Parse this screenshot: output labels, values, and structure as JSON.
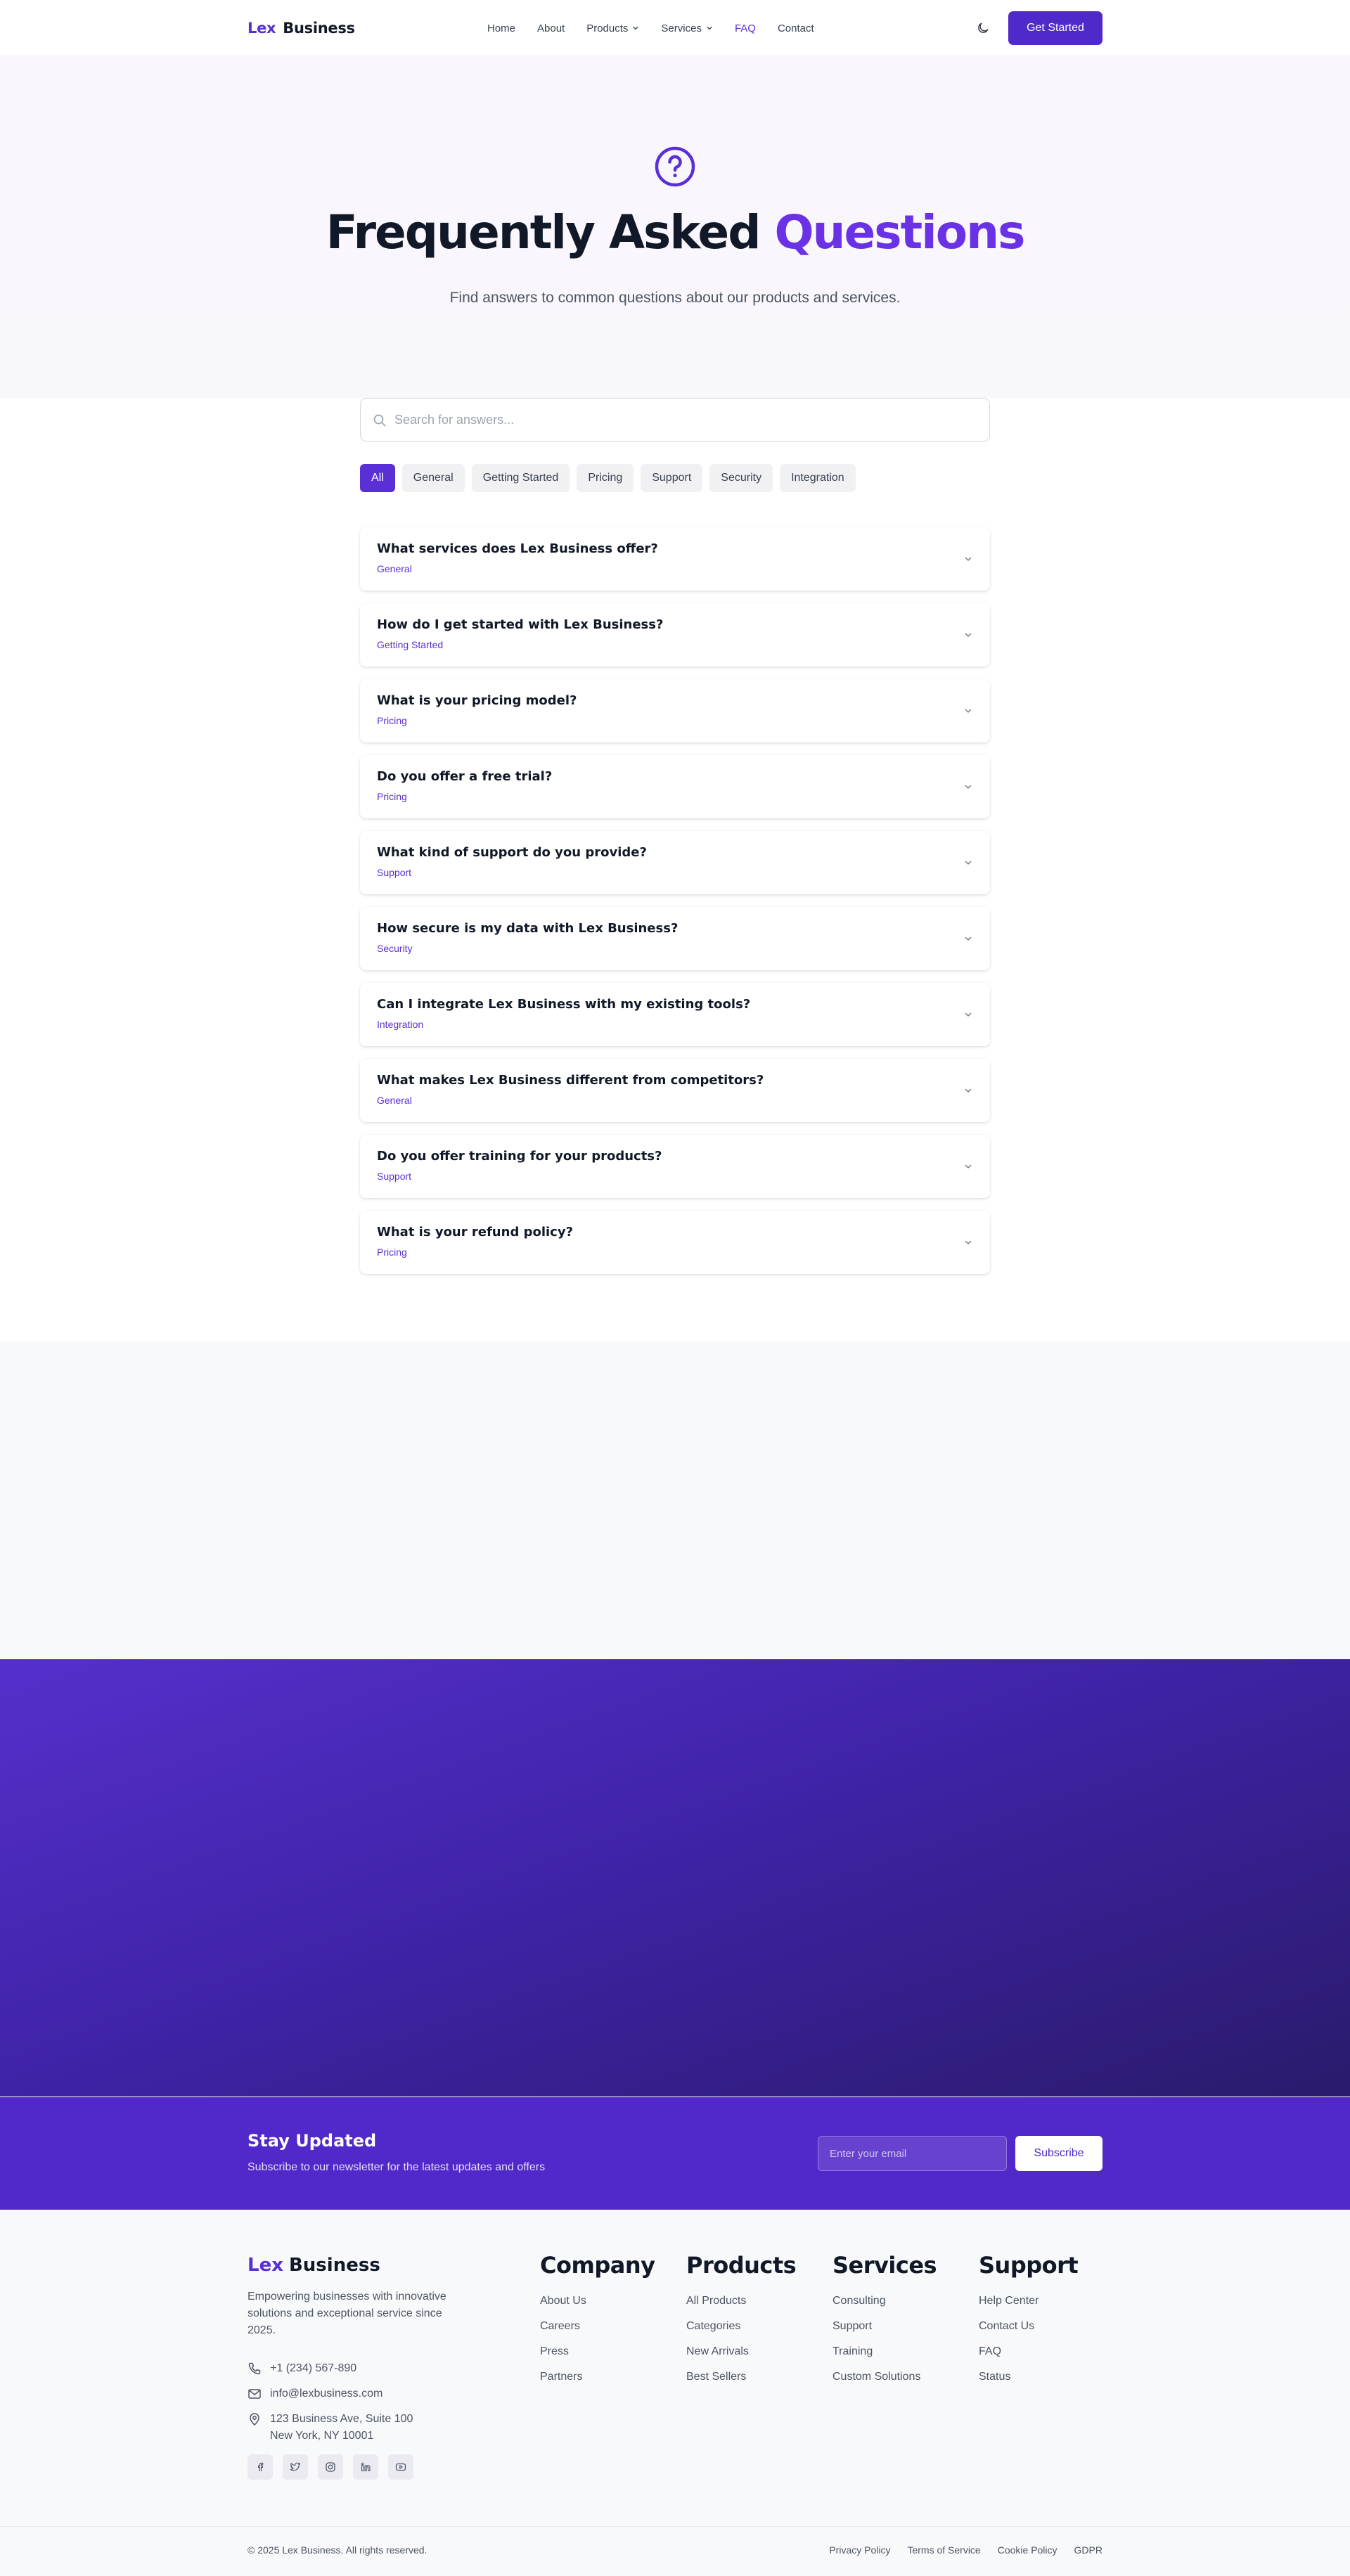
{
  "nav": {
    "logo_lex": "Lex",
    "logo_business": "Business",
    "items": [
      {
        "label": "Home"
      },
      {
        "label": "About"
      },
      {
        "label": "Products"
      },
      {
        "label": "Services"
      },
      {
        "label": "FAQ"
      },
      {
        "label": "Contact"
      }
    ],
    "active_item": "FAQ",
    "cta_label": "Get Started",
    "theme_icon": "moon-icon"
  },
  "hero": {
    "icon": "question-circle-icon",
    "title_main": "Frequently Asked",
    "title_accent": "Questions",
    "subtitle": "Find answers to common questions about our products and services."
  },
  "search": {
    "placeholder": "Search for answers...",
    "value": ""
  },
  "filters": {
    "active": "All",
    "items": [
      "All",
      "General",
      "Getting Started",
      "Pricing",
      "Support",
      "Security",
      "Integration"
    ]
  },
  "faqs": [
    {
      "question": "What services does Lex Business offer?",
      "category": "General"
    },
    {
      "question": "How do I get started with Lex Business?",
      "category": "Getting Started"
    },
    {
      "question": "What is your pricing model?",
      "category": "Pricing"
    },
    {
      "question": "Do you offer a free trial?",
      "category": "Pricing"
    },
    {
      "question": "What kind of support do you provide?",
      "category": "Support"
    },
    {
      "question": "How secure is my data with Lex Business?",
      "category": "Security"
    },
    {
      "question": "Can I integrate Lex Business with my existing tools?",
      "category": "Integration"
    },
    {
      "question": "What makes Lex Business different from competitors?",
      "category": "General"
    },
    {
      "question": "Do you offer training for your products?",
      "category": "Support"
    },
    {
      "question": "What is your refund policy?",
      "category": "Pricing"
    }
  ],
  "newsletter": {
    "title": "Stay Updated",
    "subtitle": "Subscribe to our newsletter for the latest updates and offers",
    "placeholder": "Enter your email",
    "button_label": "Subscribe"
  },
  "footer": {
    "logo_lex": "Lex",
    "logo_business": "Business",
    "description": "Empowering businesses with innovative solutions and exceptional service since 2025.",
    "phone": "+1 (234) 567-890",
    "email": "info@lexbusiness.com",
    "address_line1": "123 Business Ave, Suite 100",
    "address_line2": "New York, NY 10001",
    "socials": [
      "facebook-icon",
      "twitter-icon",
      "instagram-icon",
      "linkedin-icon",
      "youtube-icon"
    ],
    "columns": [
      {
        "title": "Company",
        "links": [
          "About Us",
          "Careers",
          "Press",
          "Partners"
        ]
      },
      {
        "title": "Products",
        "links": [
          "All Products",
          "Categories",
          "New Arrivals",
          "Best Sellers"
        ]
      },
      {
        "title": "Services",
        "links": [
          "Consulting",
          "Support",
          "Training",
          "Custom Solutions"
        ]
      },
      {
        "title": "Support",
        "links": [
          "Help Center",
          "Contact Us",
          "FAQ",
          "Status"
        ]
      }
    ],
    "copyright": "© 2025 Lex Business. All rights reserved.",
    "legal_links": [
      "Privacy Policy",
      "Terms of Service",
      "Cookie Policy",
      "GDPR"
    ]
  },
  "colors": {
    "accent": "#5b2fd6",
    "accent_dark": "#4f29c9",
    "text": "#111827",
    "muted": "#4b5563"
  }
}
